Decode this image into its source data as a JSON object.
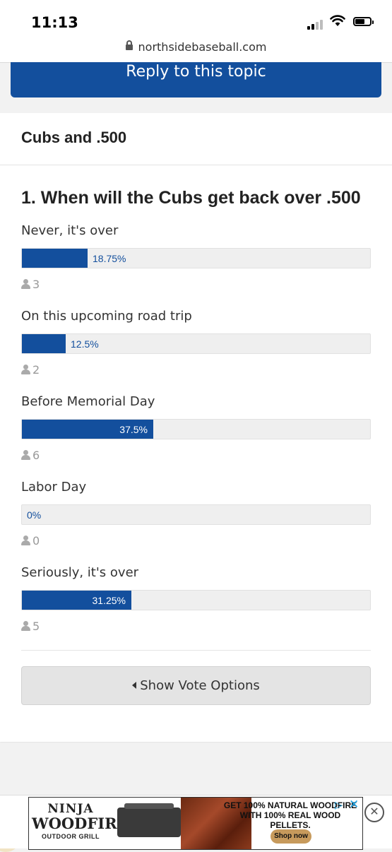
{
  "status_bar": {
    "time": "11:13",
    "signal_icon": "cellular-signal-icon",
    "wifi_icon": "wifi-icon",
    "battery_icon": "battery-icon"
  },
  "browser": {
    "url": "northsidebaseball.com",
    "lock_icon": "lock-icon"
  },
  "reply_button": {
    "label": "Reply to this topic"
  },
  "topic": {
    "title": "Cubs and .500"
  },
  "poll": {
    "question": "1. When will the Cubs get back over .500",
    "accent_color": "#134f9d",
    "options": [
      {
        "label": "Never, it's over",
        "percent_label": "18.75%",
        "percent": 18.75,
        "votes": "3"
      },
      {
        "label": "On this upcoming road trip",
        "percent_label": "12.5%",
        "percent": 12.5,
        "votes": "2"
      },
      {
        "label": "Before Memorial Day",
        "percent_label": "37.5%",
        "percent": 37.5,
        "votes": "6"
      },
      {
        "label": "Labor Day",
        "percent_label": "0%",
        "percent": 0,
        "votes": "0"
      },
      {
        "label": "Seriously, it's over",
        "percent_label": "31.25%",
        "percent": 31.25,
        "votes": "5"
      }
    ],
    "show_vote_label": "Show Vote Options"
  },
  "ad": {
    "brand_line1": "NINJA",
    "brand_line2": "WOODFIRE",
    "brand_line3": "OUTDOOR GRILL",
    "headline_line1": "GET 100% NATURAL WOODFIRE",
    "headline_line2": "WITH 100% REAL WOOD PELLETS.",
    "cta": "Shop now",
    "close_label": "✕"
  }
}
